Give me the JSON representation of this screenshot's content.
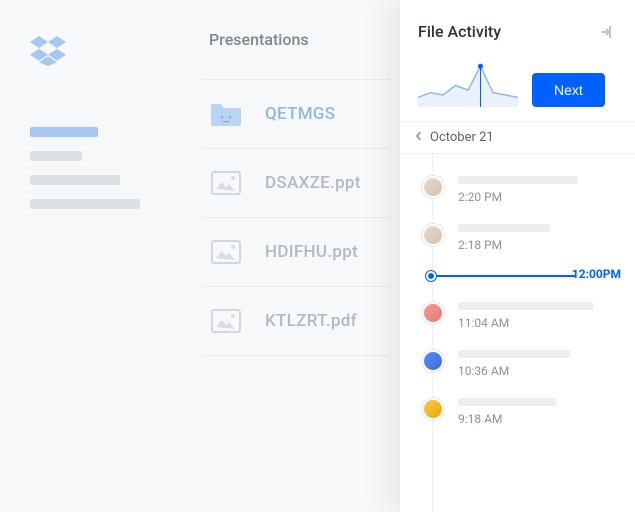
{
  "sidebar": {
    "logo": "dropbox-logo"
  },
  "fileList": {
    "title": "Presentations",
    "files": [
      {
        "name": "QETMGS",
        "type": "folder",
        "selected": true
      },
      {
        "name": "DSAXZE.ppt",
        "type": "image"
      },
      {
        "name": "HDIFHU.ppt",
        "type": "image"
      },
      {
        "name": "KTLZRT.pdf",
        "type": "image"
      }
    ]
  },
  "panel": {
    "title": "File Activity",
    "next_label": "Next",
    "date_label": "October 21",
    "marker_label": "12:00PM",
    "activities": [
      {
        "avatar": "beige",
        "time": "2:20 PM",
        "skel_w": 120
      },
      {
        "avatar": "beige",
        "time": "2:18 PM",
        "skel_w": 92
      },
      {
        "avatar": "pink",
        "time": "11:04 AM",
        "skel_w": 135
      },
      {
        "avatar": "blue",
        "time": "10:36 AM",
        "skel_w": 112
      },
      {
        "avatar": "yellow",
        "time": "9:18 AM",
        "skel_w": 98
      }
    ]
  },
  "chart_data": {
    "type": "area",
    "title": "File Activity",
    "x": [
      0,
      1,
      2,
      3,
      4,
      5,
      6,
      7,
      8
    ],
    "values": [
      8,
      12,
      10,
      18,
      14,
      34,
      12,
      10,
      8
    ],
    "ylim": [
      0,
      40
    ],
    "marker_index": 5,
    "xlabel": "",
    "ylabel": ""
  }
}
